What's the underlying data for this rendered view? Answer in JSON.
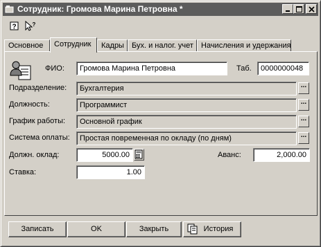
{
  "window": {
    "title": "Сотрудник: Громова Марина Петровна *"
  },
  "tabs": [
    {
      "label": "Основное",
      "active": false
    },
    {
      "label": "Сотрудник",
      "active": true
    },
    {
      "label": "Кадры",
      "active": false
    },
    {
      "label": "Бух. и налог. учет",
      "active": false
    },
    {
      "label": "Начисления и удержания",
      "active": false
    }
  ],
  "form": {
    "fio_label": "ФИО:",
    "fio_value": "Громова Марина Петровна",
    "tab_label": "Таб.",
    "tab_value": "0000000048",
    "department_label": "Подразделение:",
    "department_value": "Бухгалтерия",
    "position_label": "Должность:",
    "position_value": "Программист",
    "schedule_label": "График работы:",
    "schedule_value": "Основной график",
    "payment_label": "Система оплаты:",
    "payment_value": "Простая повременная по окладу (по дням)",
    "salary_label": "Должн. оклад:",
    "salary_value": "5000.00",
    "advance_label": "Аванс:",
    "advance_value": "2,000.00",
    "rate_label": "Ставка:",
    "rate_value": "1.00",
    "select_button": "..."
  },
  "buttons": {
    "save": "Записать",
    "ok": "OK",
    "close": "Закрыть",
    "history": "История"
  },
  "icons": [
    "window-icon",
    "minimize-icon",
    "maximize-icon",
    "close-icon",
    "help-icon",
    "whats-this-icon",
    "employee-card-icon",
    "calculator-icon",
    "history-icon"
  ]
}
